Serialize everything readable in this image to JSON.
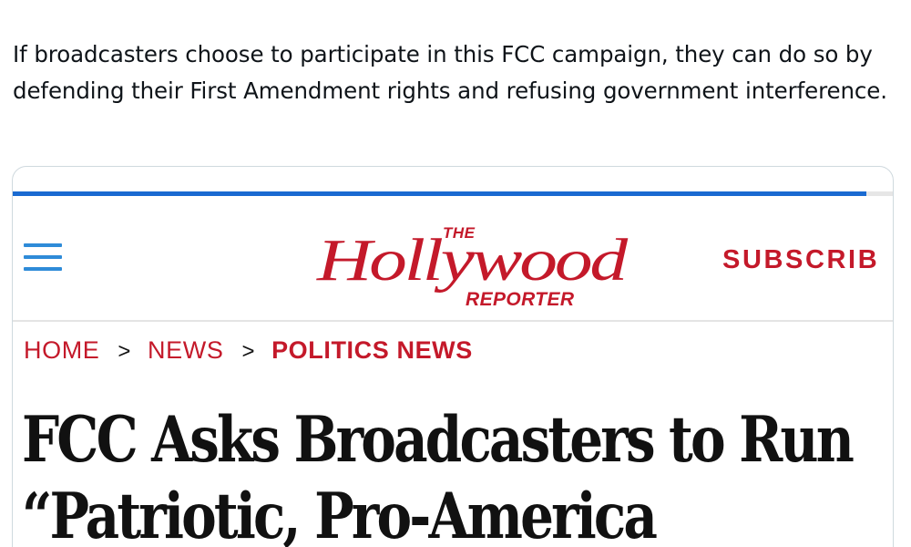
{
  "tweet": {
    "text": "If broadcasters choose to participate in this FCC campaign, they can do so by defending their First Amendment rights and refusing government interference."
  },
  "article_card": {
    "progress": 0.97,
    "colors": {
      "progress": "#1a6ad1",
      "brand_red": "#c4192a",
      "menu_blue": "#2e8bd8"
    },
    "menu_icon": "hamburger-menu-icon",
    "logo": {
      "the": "THE",
      "name": "Hollywood",
      "reporter": "REPORTER"
    },
    "subscribe_label": "SUBSCRIB",
    "breadcrumb": {
      "home": "HOME",
      "separator": ">",
      "news": "NEWS",
      "current": "POLITICS NEWS"
    },
    "headline_line1": "FCC Asks Broadcasters to Run",
    "headline_line2": "“Patriotic, Pro-America"
  }
}
